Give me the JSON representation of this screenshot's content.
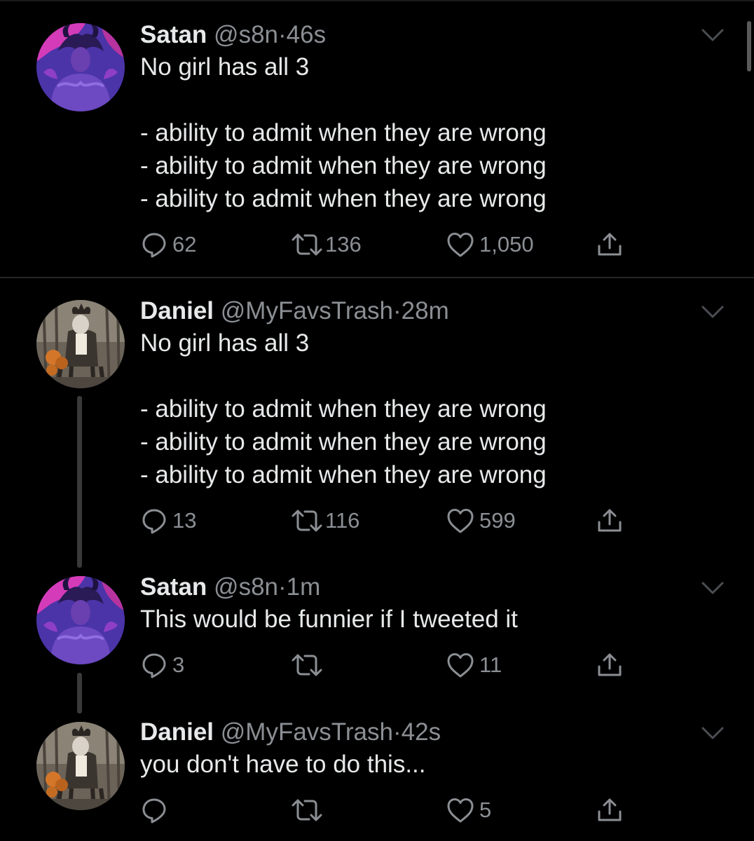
{
  "colors": {
    "background": "#000000",
    "text_primary": "#e7e9ea",
    "text_secondary": "#8b8f94",
    "divider": "#262626"
  },
  "tweets": [
    {
      "author": {
        "name": "Satan",
        "handle": "@s8n"
      },
      "time": "46s",
      "separator": "·",
      "text": "No girl has all 3\n\n- ability to admit when they are wrong\n- ability to admit when they are wrong\n- ability to admit when they are wrong",
      "stats": {
        "replies": "62",
        "retweets": "136",
        "likes": "1,050"
      },
      "avatar_icon": "demon-avatar"
    },
    {
      "author": {
        "name": "Daniel",
        "handle": "@MyFavsTrash"
      },
      "time": "28m",
      "separator": "·",
      "text": "No girl has all 3\n\n- ability to admit when they are wrong\n- ability to admit when they are wrong\n- ability to admit when they are wrong",
      "stats": {
        "replies": "13",
        "retweets": "116",
        "likes": "599"
      },
      "avatar_icon": "deer-rider-avatar"
    },
    {
      "author": {
        "name": "Satan",
        "handle": "@s8n"
      },
      "time": "1m",
      "separator": "·",
      "text": "This would be funnier if I tweeted it",
      "stats": {
        "replies": "3",
        "retweets": "",
        "likes": "11"
      },
      "avatar_icon": "demon-avatar"
    },
    {
      "author": {
        "name": "Daniel",
        "handle": "@MyFavsTrash"
      },
      "time": "42s",
      "separator": "·",
      "text": "you don't have to do this...",
      "stats": {
        "replies": "",
        "retweets": "",
        "likes": "5"
      },
      "avatar_icon": "deer-rider-avatar"
    }
  ],
  "icons": {
    "reply": "speech-bubble-icon",
    "retweet": "retweet-arrows-icon",
    "like": "heart-icon",
    "share": "share-upload-icon",
    "more": "chevron-down-icon"
  }
}
